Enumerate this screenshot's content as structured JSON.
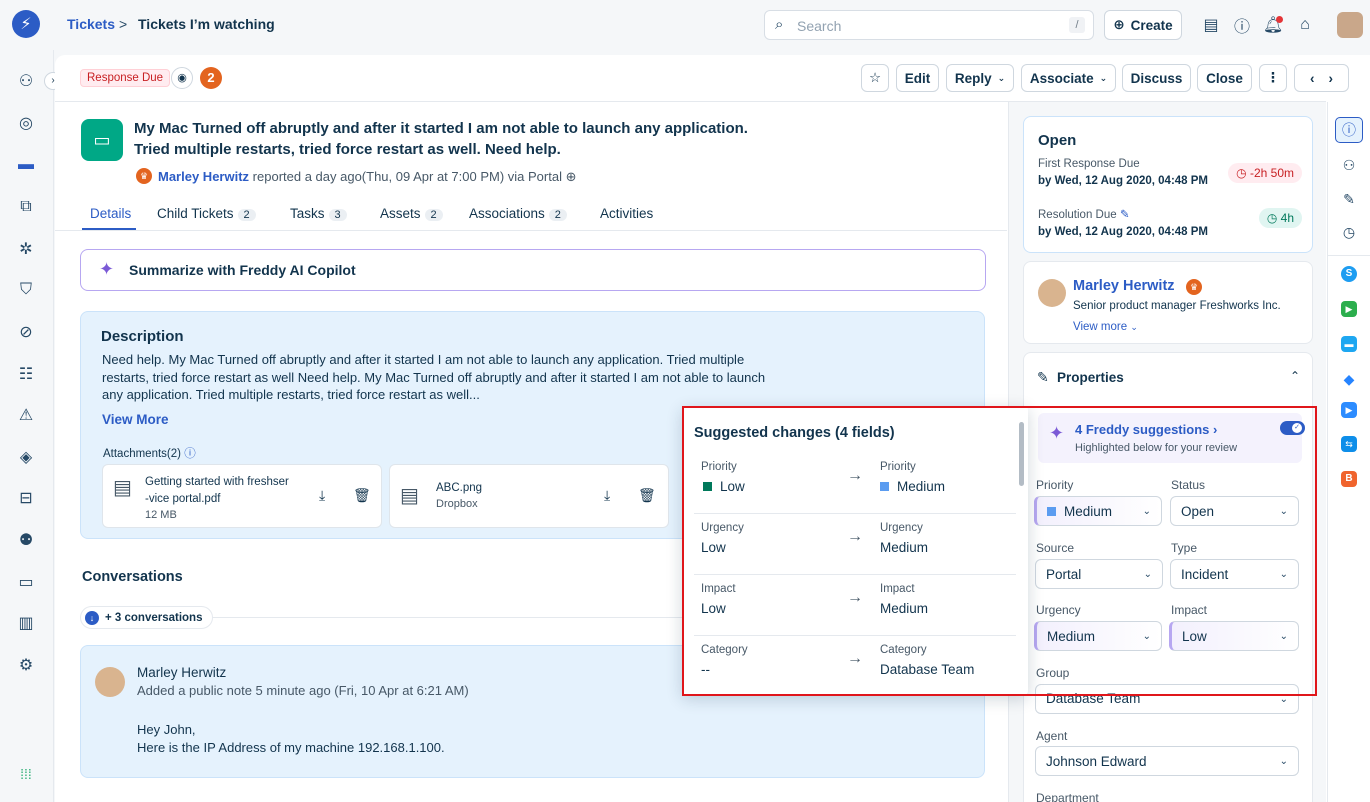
{
  "breadcrumb": {
    "root": "Tickets",
    "separator": ">",
    "current": "Tickets I’m watching"
  },
  "search": {
    "placeholder": "Search",
    "shortcut": "/"
  },
  "header": {
    "create_label": "Create"
  },
  "ticket_bar": {
    "status_badge": "Response Due",
    "watcher_count": "2",
    "actions": {
      "edit": "Edit",
      "reply": "Reply",
      "associate": "Associate",
      "discuss": "Discuss",
      "close": "Close"
    }
  },
  "ticket": {
    "title_line1": "My Mac Turned off abruptly and after it started I am not able to launch any application.",
    "title_line2": "Tried multiple restarts, tried force restart as well. Need help.",
    "reporter": "Marley Herwitz",
    "reported_text": "reported a day ago(Thu, 09 Apr at 7:00 PM) via Portal"
  },
  "tabs": [
    {
      "label": "Details",
      "count": ""
    },
    {
      "label": "Child Tickets",
      "count": "2"
    },
    {
      "label": "Tasks",
      "count": "3"
    },
    {
      "label": "Assets",
      "count": "2"
    },
    {
      "label": "Associations",
      "count": "2"
    },
    {
      "label": "Activities",
      "count": ""
    }
  ],
  "freddy": {
    "label": "Summarize with Freddy AI Copilot"
  },
  "description": {
    "heading": "Description",
    "line1": "Need help. My Mac Turned off abruptly and after it started I am not able to launch any application. Tried multiple",
    "line2": "restarts, tried force restart as well Need help. My Mac Turned off abruptly and after it started I am not able to launch",
    "line3": "any application. Tried multiple restarts, tried force restart as well...",
    "view_more": "View More",
    "attachments_label": "Attachments(2)",
    "attachments": [
      {
        "name1": "Getting started with freshser",
        "name2": "-vice portal.pdf",
        "meta": "12 MB"
      },
      {
        "name1": "ABC.png",
        "name2": "",
        "meta": "Dropbox"
      }
    ]
  },
  "conversations": {
    "heading": "Conversations",
    "more": "+ 3 conversations",
    "item": {
      "author": "Marley Herwitz",
      "meta": "Added a public note 5 minute ago (Fri, 10 Apr at 6:21 AM)",
      "line1": "Hey John,",
      "line2": "Here is the IP Address of my machine 192.168.1.100."
    }
  },
  "status_card": {
    "status": "Open",
    "first_response_label": "First Response Due",
    "first_response_date": "by Wed, 12 Aug 2020, 04:48 PM",
    "first_response_sla": "-2h 50m",
    "resolution_label": "Resolution Due",
    "resolution_date": "by Wed, 12 Aug 2020, 04:48 PM",
    "resolution_sla": "4h"
  },
  "requester": {
    "name": "Marley Herwitz",
    "title": "Senior product manager Freshworks Inc.",
    "view_more": "View more"
  },
  "properties": {
    "heading": "Properties",
    "freddy_title": "4 Freddy suggestions",
    "freddy_sub": "Highlighted below for your review",
    "fields": {
      "priority_label": "Priority",
      "priority": "Medium",
      "status_label": "Status",
      "status": "Open",
      "source_label": "Source",
      "source": "Portal",
      "type_label": "Type",
      "type": "Incident",
      "urgency_label": "Urgency",
      "urgency": "Medium",
      "impact_label": "Impact",
      "impact": "Low",
      "group_label": "Group",
      "group": "Database Team",
      "agent_label": "Agent",
      "agent": "Johnson Edward",
      "department_label": "Department"
    }
  },
  "suggestions": {
    "title": "Suggested changes (4 fields)",
    "rows": [
      {
        "field": "Priority",
        "from": "Low",
        "to": "Medium",
        "from_color": "#00795b",
        "to_color": "#5b9cf0"
      },
      {
        "field": "Urgency",
        "from": "Low",
        "to": "Medium"
      },
      {
        "field": "Impact",
        "from": "Low",
        "to": "Medium"
      },
      {
        "field": "Category",
        "from": "--",
        "to": "Database Team"
      }
    ]
  },
  "colors": {
    "primary": "#2c5cc5",
    "danger_highlight": "#e0161b",
    "freddy": "#7b5ad6",
    "success": "#00a886"
  }
}
